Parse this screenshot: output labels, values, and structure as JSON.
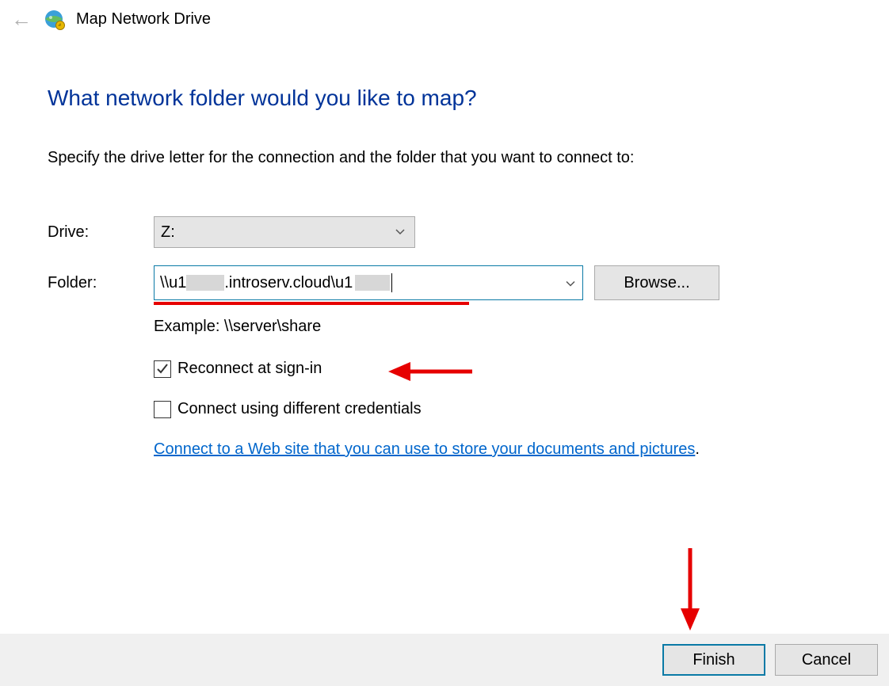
{
  "window": {
    "title": "Map Network Drive"
  },
  "heading": "What network folder would you like to map?",
  "instruction": "Specify the drive letter for the connection and the folder that you want to connect to:",
  "labels": {
    "drive": "Drive:",
    "folder": "Folder:"
  },
  "drive": {
    "value": "Z:"
  },
  "folder": {
    "prefix": "\\\\u1",
    "mid": ".introserv.cloud\\u1",
    "example": "Example: \\\\server\\share"
  },
  "browse_label": "Browse...",
  "checkboxes": {
    "reconnect": {
      "label": "Reconnect at sign-in",
      "checked": true
    },
    "credentials": {
      "label": "Connect using different credentials",
      "checked": false
    }
  },
  "link_text": "Connect to a Web site that you can use to store your documents and pictures",
  "link_suffix": ".",
  "footer": {
    "finish": "Finish",
    "cancel": "Cancel"
  },
  "annotation": {
    "color": "#e60000"
  }
}
